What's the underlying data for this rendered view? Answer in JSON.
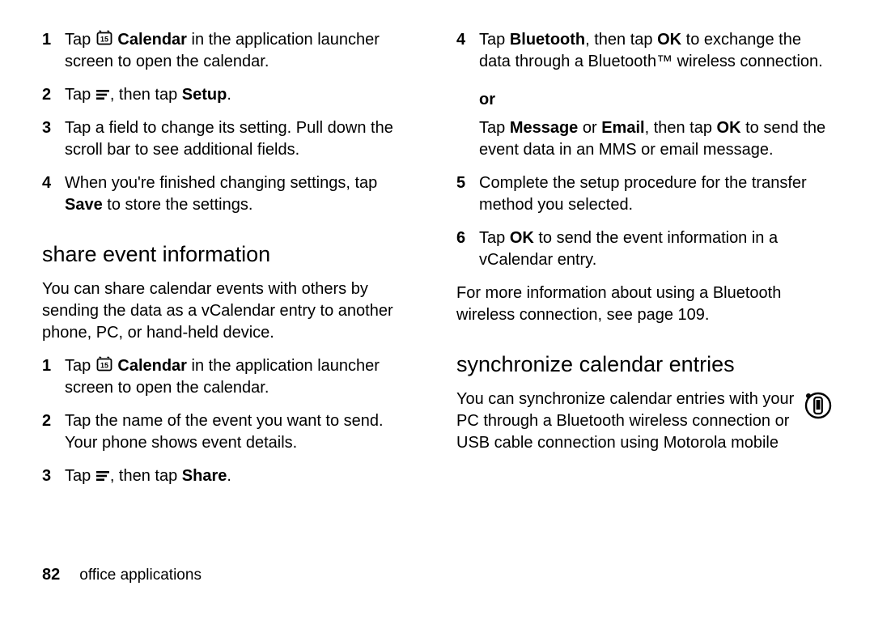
{
  "left": {
    "steps_a": [
      {
        "n": "1",
        "parts": [
          "Tap ",
          "@CAL",
          " ",
          "@B:Calendar",
          " in the application launcher screen to open the calendar."
        ]
      },
      {
        "n": "2",
        "parts": [
          "Tap ",
          "@MENU",
          ", then tap ",
          "@B:Setup",
          "."
        ]
      },
      {
        "n": "3",
        "parts": [
          "Tap a field to change its setting. Pull down the scroll bar to see additional fields."
        ]
      },
      {
        "n": "4",
        "parts": [
          "When you're finished changing settings, tap ",
          "@B:Save",
          " to store the settings."
        ]
      }
    ],
    "heading": "share event information",
    "para": "You can share calendar events with others by sending the data as a vCalendar entry to another phone, PC, or hand-held device.",
    "steps_b": [
      {
        "n": "1",
        "parts": [
          "Tap ",
          "@CAL",
          " ",
          "@B:Calendar",
          " in the application launcher screen to open the calendar."
        ]
      },
      {
        "n": "2",
        "parts": [
          "Tap the name of the event you want to send. Your phone shows event details."
        ]
      },
      {
        "n": "3",
        "parts": [
          "Tap ",
          "@MENU",
          ", then tap ",
          "@B:Share",
          "."
        ]
      }
    ]
  },
  "right": {
    "steps_c": [
      {
        "n": "4",
        "parts": [
          "Tap ",
          "@B:Bluetooth",
          ", then tap ",
          "@B:OK",
          " to exchange the data through a Bluetooth™ wireless connection."
        ]
      }
    ],
    "or_label": "or",
    "or_para_parts": [
      "Tap ",
      "@B:Message",
      " or ",
      "@B:Email",
      ", then tap ",
      "@B:OK",
      " to send the event data in an MMS or email message."
    ],
    "steps_d": [
      {
        "n": "5",
        "parts": [
          "Complete the setup procedure for the transfer method you selected."
        ]
      },
      {
        "n": "6",
        "parts": [
          "Tap ",
          "@B:OK",
          " to send the event information in a vCalendar entry."
        ]
      }
    ],
    "para_after": "For more information about using a Bluetooth wireless connection, see page 109.",
    "heading": "synchronize calendar entries",
    "sync_para": "You can synchronize calendar entries with your PC through a Bluetooth wireless connection or USB cable connection using Motorola mobile"
  },
  "footer": {
    "page": "82",
    "label": "office applications"
  }
}
